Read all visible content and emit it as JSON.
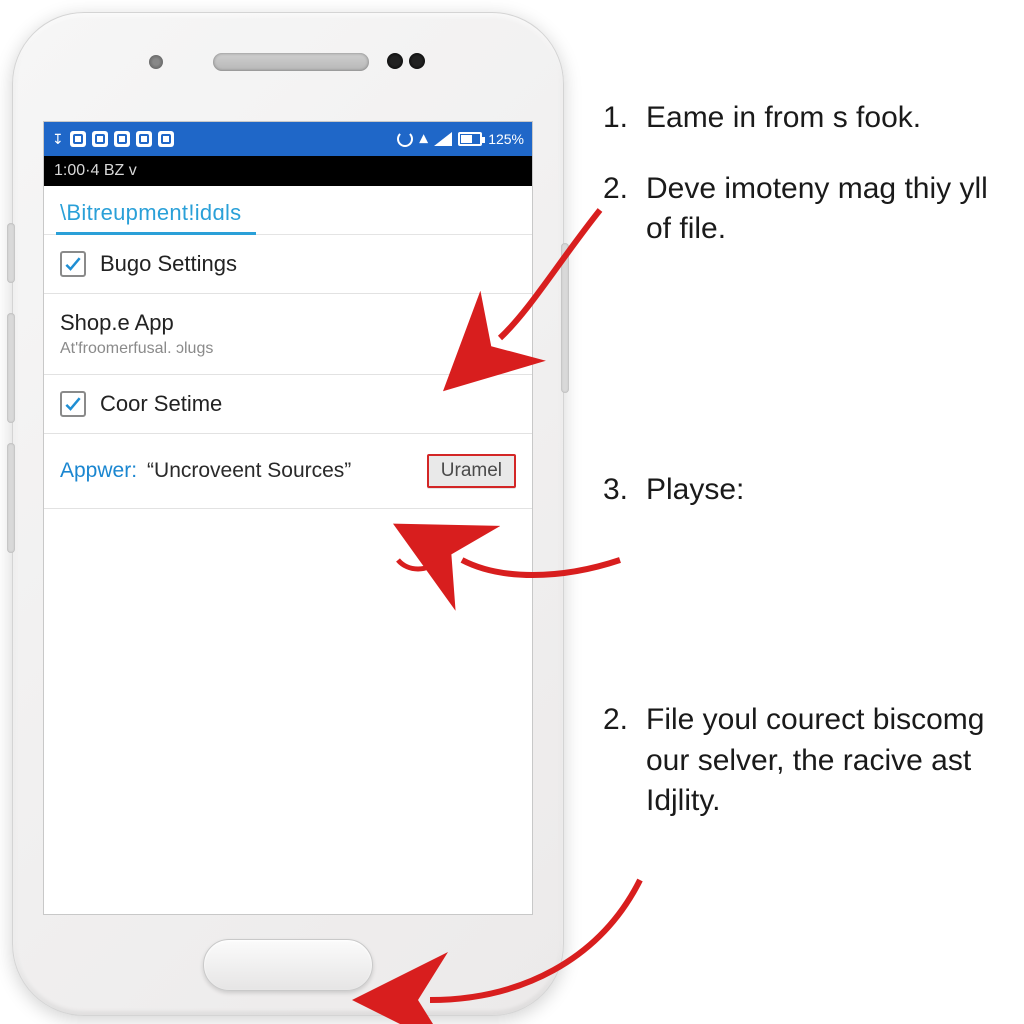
{
  "phone": {
    "statusbar": {
      "battery_pct": "125%"
    },
    "timebar": {
      "time": "1:00·4 BZ v"
    },
    "app": {
      "tab_label": "\\Bitreupment!idɑls",
      "row1_label": "Bugo Settings",
      "row2_label": "Shop.e App",
      "row2_sub": "At'froomerfusal. ɔlugs",
      "row3_label": "Coor Setime",
      "row4_key": "Appwer:",
      "row4_val": "“Uncroveent Sources”",
      "row4_btn": "Uramel"
    }
  },
  "steps": {
    "s1_n": "1.",
    "s1_t": "Eame in from s fook.",
    "s2_n": "2.",
    "s2_t": "Deve imoteny mag thiy yll of file.",
    "s3_n": "3.",
    "s3_t": "Playse:",
    "s4_n": "2.",
    "s4_t": "File youl courect biscomg our selver, the racive ast Idjlity."
  }
}
